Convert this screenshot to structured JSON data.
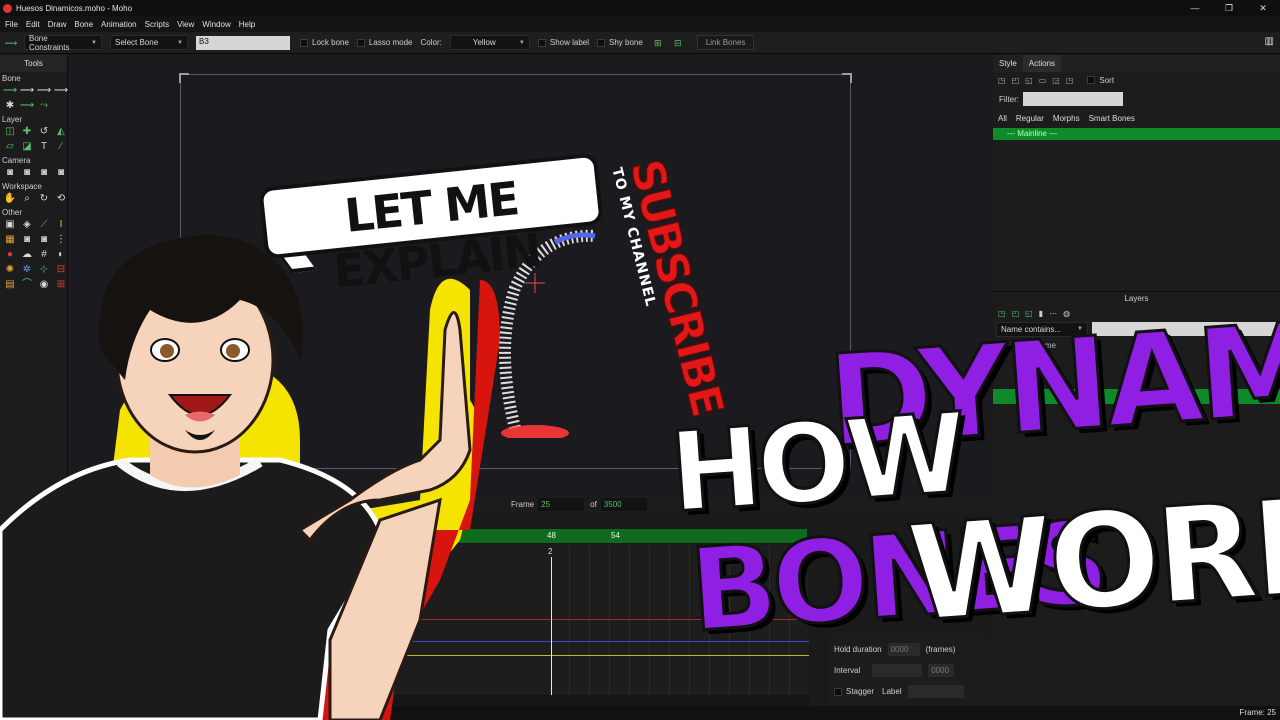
{
  "window": {
    "title": "Huesos Dinamicos.moho - Moho",
    "controls": [
      "—",
      "❐",
      "✕"
    ]
  },
  "menu": [
    "File",
    "Edit",
    "Draw",
    "Bone",
    "Animation",
    "Scripts",
    "View",
    "Window",
    "Help"
  ],
  "toolbar": {
    "bone_constraints": "Bone Constraints",
    "select_bone": "Select Bone",
    "bone_name_value": "B3",
    "lock_bone": "Lock bone",
    "lasso_mode": "Lasso mode",
    "color_label": "Color:",
    "color_value": "Yellow",
    "show_label": "Show label",
    "shy_bone": "Shy bone",
    "link_bones": "Link Bones"
  },
  "tools": {
    "title": "Tools",
    "sections": [
      "Bone",
      "Layer",
      "Camera",
      "Workspace",
      "Other"
    ],
    "layer_text_tool": "T"
  },
  "timeline": {
    "frame_label": "Frame",
    "frame_value": "25",
    "of_label": "of",
    "total_frames": "3500",
    "ruler_ticks": [
      "48",
      "54"
    ],
    "playhead": "2"
  },
  "properties": {
    "hold_duration": "Hold duration",
    "hold_value": "0000",
    "frames_unit": "(frames)",
    "interval": "Interval",
    "interval_value": "0000",
    "stagger": "Stagger",
    "label": "Label"
  },
  "right_panel": {
    "tabs": [
      "Style",
      "Actions"
    ],
    "sort": "Sort",
    "filter_label": "Filter:",
    "subtabs": [
      "All",
      "Regular",
      "Morphs",
      "Smart Bones"
    ],
    "mainline": "--- Mainline ---"
  },
  "layers_panel": {
    "title": "Layers",
    "name_filter": "Name contains...",
    "column_name": "Name"
  },
  "status": {
    "frame_readout": "Frame: 25"
  },
  "thumbnail": {
    "bubble": "LET ME EXPLAIN",
    "subscribe": "SUBSCRIBE",
    "to_channel": "TO MY CHANNEL",
    "headline_how": "HOW",
    "headline_dynamic": "DYNAMIC",
    "headline_bones": "BONES",
    "headline_work": "WORK"
  },
  "colors": {
    "accent_green": "#0f8a2a",
    "headline_purple": "#8e1fe3",
    "subscribe_red": "#e01818",
    "outline_yellow": "#f4e400"
  }
}
